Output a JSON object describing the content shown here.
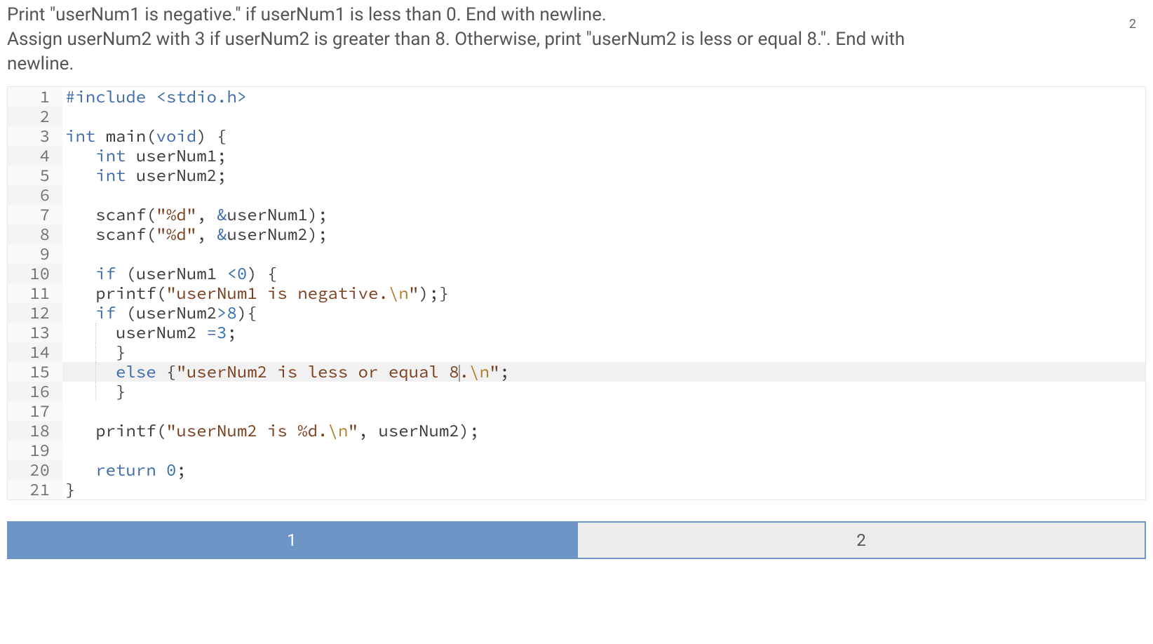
{
  "instructions": {
    "line1": "Print \"userNum1 is negative.\" if userNum1 is less than 0. End with newline.",
    "line2": "Assign userNum2 with 3 if userNum2 is greater than 8. Otherwise, print \"userNum2 is less or equal 8.\". End with newline."
  },
  "badge": "2",
  "code": {
    "lines": [
      {
        "n": "1"
      },
      {
        "n": "2"
      },
      {
        "n": "3"
      },
      {
        "n": "4"
      },
      {
        "n": "5"
      },
      {
        "n": "6"
      },
      {
        "n": "7"
      },
      {
        "n": "8"
      },
      {
        "n": "9"
      },
      {
        "n": "10"
      },
      {
        "n": "11"
      },
      {
        "n": "12"
      },
      {
        "n": "13"
      },
      {
        "n": "14"
      },
      {
        "n": "15"
      },
      {
        "n": "16"
      },
      {
        "n": "17"
      },
      {
        "n": "18"
      },
      {
        "n": "19"
      },
      {
        "n": "20"
      },
      {
        "n": "21"
      }
    ],
    "tokens": {
      "include": "#include",
      "stdio": "<stdio.h>",
      "int": "int",
      "main": "main",
      "void": "void",
      "userNum1": "userNum1",
      "userNum2": "userNum2",
      "scanf": "scanf",
      "fmt_d": "\"%d\"",
      "amp_u1": "&userNum1",
      "amp_u2": "&userNum2",
      "if": "if",
      "lt0": "<",
      "zero": "0",
      "printf": "printf",
      "str_neg_open": "\"userNum1 is negative.",
      "esc_n": "\\n",
      "str_close": "\"",
      "gt": ">",
      "eight": "8",
      "assign3": "=",
      "three": "3",
      "else": "else",
      "str_leq_open": "\"userNum2 is less or equal 8",
      "dot": ".",
      "str_u2_open": "\"userNum2 is %d.",
      "return": "return",
      "semi": ";",
      "comma": ",",
      "lparen": "(",
      "rparen": ")",
      "lbrace": "{",
      "rbrace": "}",
      "sp3": "   ",
      "sp6": "      "
    }
  },
  "tabs": {
    "tab1": "1",
    "tab2": "2"
  }
}
